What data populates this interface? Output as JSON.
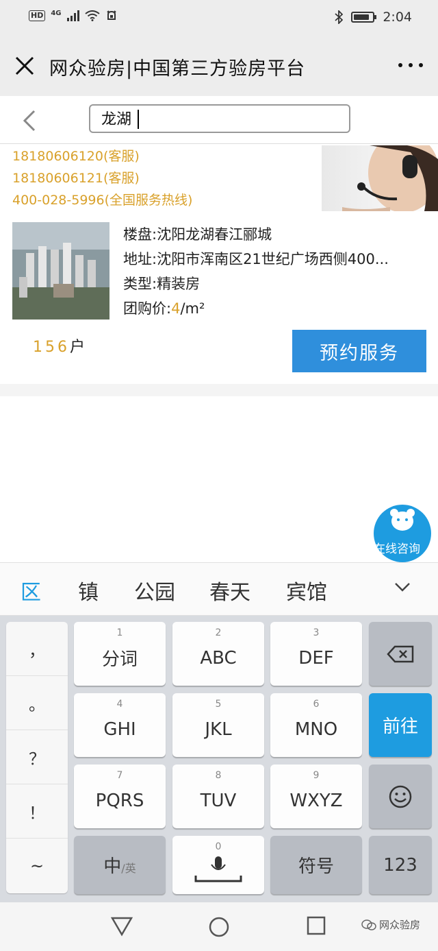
{
  "status_bar": {
    "hd": "HD",
    "net": "4G",
    "time": "2:04",
    "battery_level": 0.85,
    "icons": [
      "signal-icon",
      "wifi-icon",
      "alarm-icon",
      "bluetooth-icon",
      "battery-icon"
    ]
  },
  "appbar": {
    "title": "网众验房|中国第三方验房平台",
    "icons": [
      "close-icon",
      "more-icon"
    ]
  },
  "search": {
    "value": "龙湖",
    "icons": [
      "back-chevron-icon"
    ]
  },
  "contact": {
    "phones": [
      "18180606120(客服)",
      "18180606121(客服)",
      "400-028-5996(全国服务热线)"
    ]
  },
  "listing": {
    "building": "楼盘:沈阳龙湖春江郦城",
    "address": "地址:沈阳市浑南区21世纪广场西侧400...",
    "type": "类型:精装房",
    "price_prefix": "团购价:",
    "price_value": "4",
    "price_unit": "/m²",
    "households_count": "156",
    "households_unit": "户",
    "book_label": "预约服务"
  },
  "chat": {
    "label": "在线咨询"
  },
  "candidates": [
    "区",
    "镇",
    "公园",
    "春天",
    "宾馆"
  ],
  "keyboard": {
    "punctuation": [
      "，",
      "。",
      "？",
      "！",
      "~"
    ],
    "keys": [
      {
        "num": "1",
        "label": "分词"
      },
      {
        "num": "2",
        "label": "ABC"
      },
      {
        "num": "3",
        "label": "DEF"
      },
      {
        "num": "4",
        "label": "GHI"
      },
      {
        "num": "5",
        "label": "JKL"
      },
      {
        "num": "6",
        "label": "MNO"
      },
      {
        "num": "7",
        "label": "PQRS"
      },
      {
        "num": "8",
        "label": "TUV"
      },
      {
        "num": "9",
        "label": "WXYZ"
      }
    ],
    "go_label": "前往",
    "lang_main": "中",
    "lang_alt": "/英",
    "space_num": "0",
    "symbol_label": "符号",
    "numeric_label": "123"
  },
  "watermark": "网众验房",
  "colors": {
    "accent_blue": "#2f8fdc",
    "gold": "#d9a12b",
    "keyboard_bg": "#d8dbe0"
  }
}
